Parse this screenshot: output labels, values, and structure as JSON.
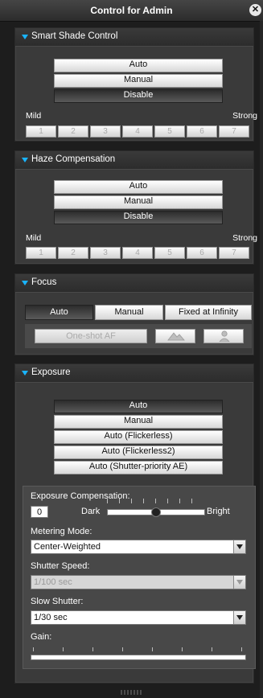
{
  "window": {
    "title": "Control for Admin"
  },
  "smart_shade": {
    "title": "Smart Shade Control",
    "modes": [
      "Auto",
      "Manual",
      "Disable"
    ],
    "selected_mode": "Disable",
    "min_label": "Mild",
    "max_label": "Strong",
    "levels": [
      "1",
      "2",
      "3",
      "4",
      "5",
      "6",
      "7"
    ]
  },
  "haze": {
    "title": "Haze Compensation",
    "modes": [
      "Auto",
      "Manual",
      "Disable"
    ],
    "selected_mode": "Disable",
    "min_label": "Mild",
    "max_label": "Strong",
    "levels": [
      "1",
      "2",
      "3",
      "4",
      "5",
      "6",
      "7"
    ]
  },
  "focus": {
    "title": "Focus",
    "modes": [
      "Auto",
      "Manual",
      "Fixed at Infinity"
    ],
    "selected_mode": "Auto",
    "one_shot_label": "One-shot AF",
    "landscape_icon": "mountain-icon",
    "portrait_icon": "person-icon"
  },
  "exposure": {
    "title": "Exposure",
    "modes": [
      "Auto",
      "Manual",
      "Auto (Flickerless)",
      "Auto (Flickerless2)",
      "Auto (Shutter-priority AE)"
    ],
    "selected_mode": "Auto",
    "compensation": {
      "label": "Exposure Compensation:",
      "value": "0",
      "dark_label": "Dark",
      "bright_label": "Bright",
      "position_fraction": 0.5
    },
    "metering": {
      "label": "Metering Mode:",
      "value": "Center-Weighted"
    },
    "shutter_speed": {
      "label": "Shutter Speed:",
      "value": "1/100 sec",
      "enabled": false
    },
    "slow_shutter": {
      "label": "Slow Shutter:",
      "value": "1/30 sec"
    },
    "gain": {
      "label": "Gain:"
    }
  },
  "colors": {
    "accent": "#19b4ff",
    "panel": "#3a3a3a",
    "selected_button": "#3a3a3a",
    "button": "#f0f0f0"
  }
}
